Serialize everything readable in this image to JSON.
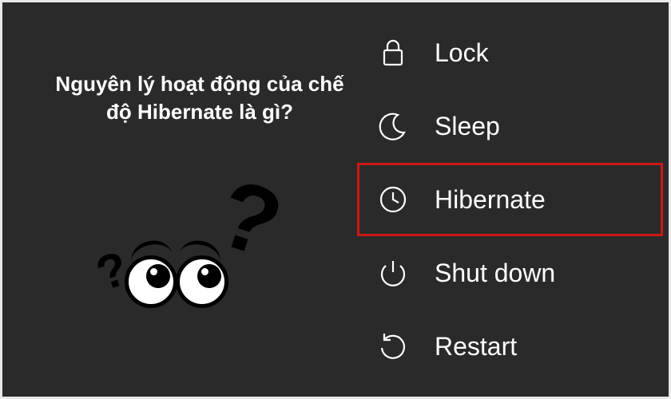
{
  "question": "Nguyên lý hoạt động của chế độ Hibernate là gì?",
  "menu": {
    "lock": {
      "label": "Lock",
      "icon": "lock-icon",
      "highlighted": false
    },
    "sleep": {
      "label": "Sleep",
      "icon": "moon-icon",
      "highlighted": false
    },
    "hibernate": {
      "label": "Hibernate",
      "icon": "clock-icon",
      "highlighted": true
    },
    "shutdown": {
      "label": "Shut down",
      "icon": "power-icon",
      "highlighted": false
    },
    "restart": {
      "label": "Restart",
      "icon": "restart-icon",
      "highlighted": false
    }
  },
  "colors": {
    "background": "#2a2a2a",
    "highlight_border": "#cc1818",
    "text": "#ffffff"
  }
}
